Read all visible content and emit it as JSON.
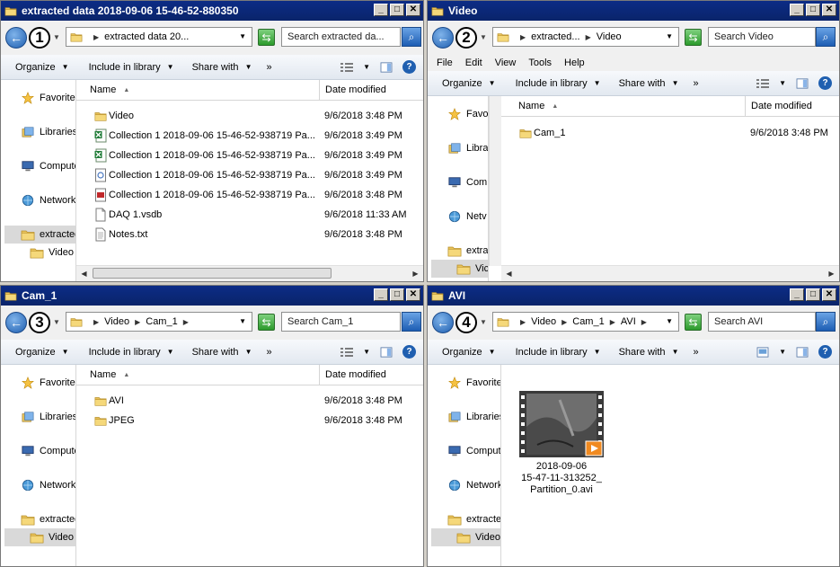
{
  "toolbar": {
    "organize": "Organize",
    "include": "Include in library",
    "share": "Share with",
    "more": "»"
  },
  "columns": {
    "name": "Name",
    "date": "Date modified"
  },
  "nav_labels": {
    "favorites": "Favorites",
    "libraries": "Libraries",
    "computer": "Computer",
    "network": "Network"
  },
  "window1": {
    "title": "extracted data 2018-09-06 15-46-52-880350",
    "badge": "1",
    "crumbs": [
      "extracted data 20..."
    ],
    "search_placeholder": "Search extracted da...",
    "nav": {
      "folder": "extracted data",
      "sub": "Video"
    },
    "rows": [
      {
        "name": "Video",
        "date": "9/6/2018 3:48 PM",
        "icon": "folder-icon"
      },
      {
        "name": "Collection 1 2018-09-06 15-46-52-938719 Pa...",
        "date": "9/6/2018 3:49 PM",
        "icon": "excel-icon"
      },
      {
        "name": "Collection 1 2018-09-06 15-46-52-938719 Pa...",
        "date": "9/6/2018 3:49 PM",
        "icon": "excel-icon"
      },
      {
        "name": "Collection 1 2018-09-06 15-46-52-938719 Pa...",
        "date": "9/6/2018 3:49 PM",
        "icon": "image-file-icon"
      },
      {
        "name": "Collection 1 2018-09-06 15-46-52-938719 Pa...",
        "date": "9/6/2018 3:48 PM",
        "icon": "pdf-icon"
      },
      {
        "name": "DAQ 1.vsdb",
        "date": "9/6/2018 11:33 AM",
        "icon": "file-icon"
      },
      {
        "name": "Notes.txt",
        "date": "9/6/2018 3:48 PM",
        "icon": "text-file-icon"
      }
    ]
  },
  "window2": {
    "title": "Video",
    "badge": "2",
    "crumbs": [
      "extracted...",
      "Video"
    ],
    "search_placeholder": "Search Video",
    "menu": [
      "File",
      "Edit",
      "View",
      "Tools",
      "Help"
    ],
    "nav": {
      "favorites": "Favo",
      "libraries": "Libra",
      "computer": "Com",
      "network": "Netv",
      "folder": "extra",
      "sub": "Vic"
    },
    "rows": [
      {
        "name": "Cam_1",
        "date": "9/6/2018 3:48 PM",
        "icon": "folder-icon"
      }
    ]
  },
  "window3": {
    "title": "Cam_1",
    "badge": "3",
    "crumbs": [
      "Video",
      "Cam_1"
    ],
    "search_placeholder": "Search Cam_1",
    "nav": {
      "folder": "extracted",
      "sub": "Video"
    },
    "rows": [
      {
        "name": "AVI",
        "date": "9/6/2018 3:48 PM",
        "icon": "folder-icon"
      },
      {
        "name": "JPEG",
        "date": "9/6/2018 3:48 PM",
        "icon": "folder-icon"
      }
    ]
  },
  "window4": {
    "title": "AVI",
    "badge": "4",
    "crumbs": [
      "Video",
      "Cam_1",
      "AVI"
    ],
    "search_placeholder": "Search AVI",
    "nav": {
      "folder": "extracted",
      "sub": "Video"
    },
    "file": {
      "line1": "2018-09-06",
      "line2": "15-47-11-313252_",
      "line3": "Partition_0.avi"
    }
  },
  "colors": {
    "titlebar": "#0a246a",
    "accent": "#1f5fb0",
    "folder": "#e8c25a"
  }
}
